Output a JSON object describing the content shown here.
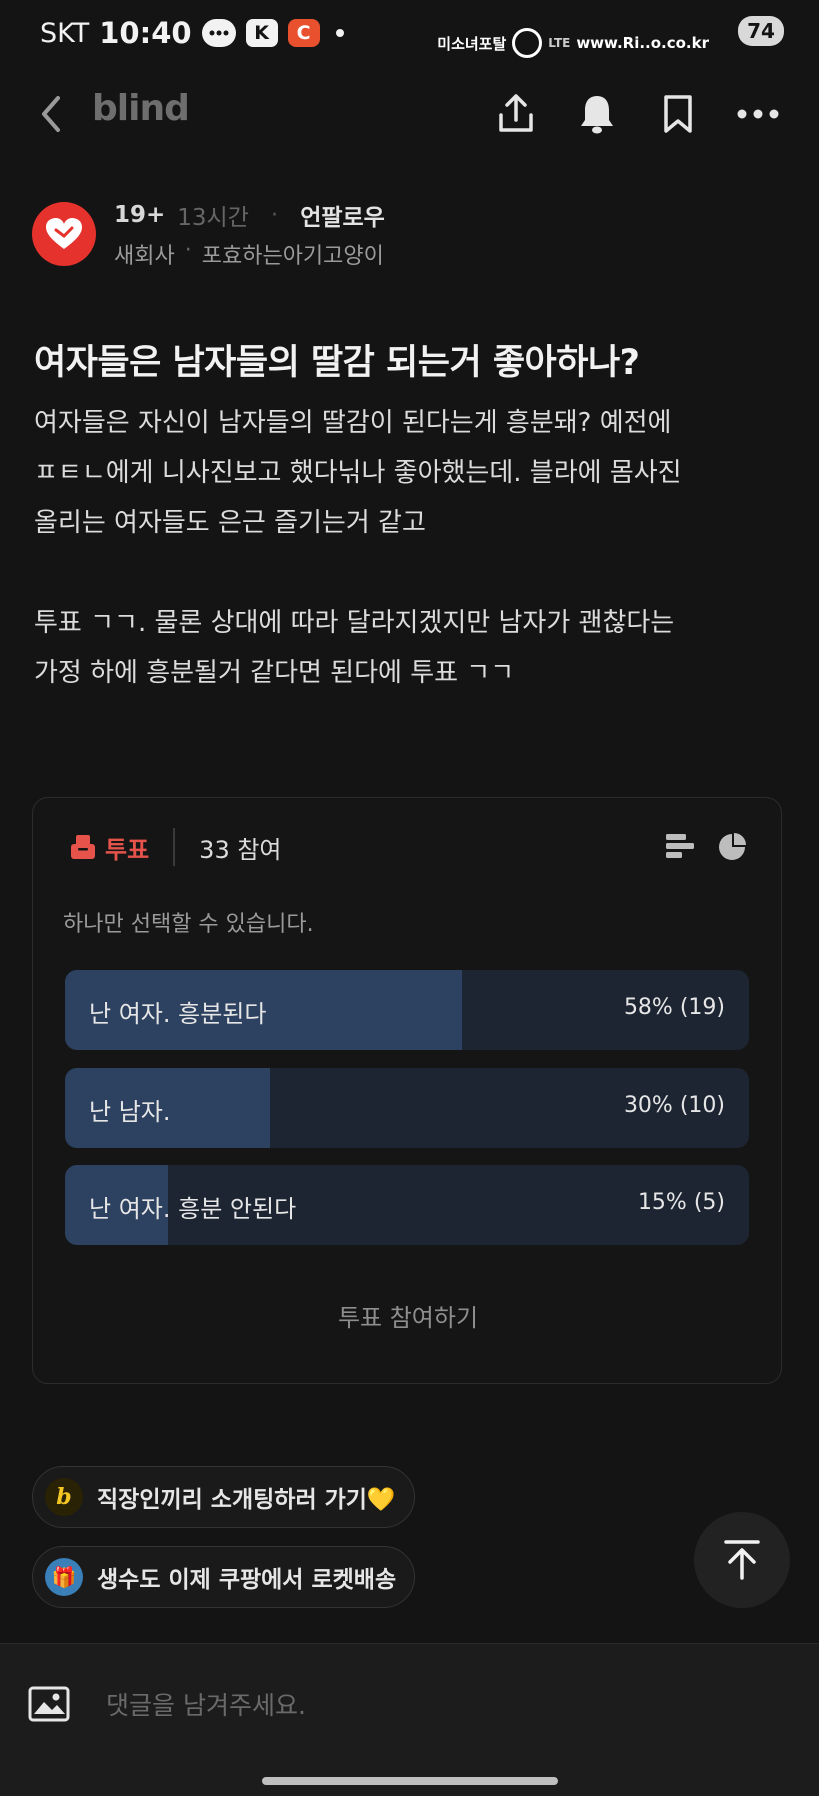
{
  "status_bar": {
    "carrier": "SKT",
    "time": "10:40",
    "k_badge": "K",
    "c_badge": "C",
    "watermark_left": "미소녀포탈",
    "watermark_right": "www.Ri..o.co.kr",
    "network": "LTE",
    "battery": "74"
  },
  "nav": {
    "logo": "blind",
    "icons": [
      "back-icon",
      "share-icon",
      "bell-icon",
      "bookmark-icon",
      "more-icon"
    ]
  },
  "author": {
    "age_badge": "19+",
    "time_ago": "13시간",
    "company": "언팔로우",
    "category": "새회사",
    "nickname": "포효하는아기고양이"
  },
  "post": {
    "title": "여자들은 남자들의 딸감 되는거 좋아하나?",
    "paragraphs": [
      "여자들은 자신이 남자들의 딸감이 된다는게 흥분돼? 예전에\nㅍㅌㄴ에게 니사진보고 했다닊나 좋아했는데. 블라에 몸사진\n올리는 여자들도 은근 즐기는거 같고",
      "투표 ㄱㄱ. 물론 상대에 따라 달라지겠지만 남자가 괜찮다는\n가정 하에 흥분될거 같다면 된다에 투표 ㄱㄱ"
    ]
  },
  "poll": {
    "label": "투표",
    "participants": "33 참여",
    "hint": "하나만 선택할 수 있습니다.",
    "options": [
      {
        "text": "난 여자. 흥분된다",
        "result": "58% (19)",
        "percent": 58
      },
      {
        "text": "난 남자.",
        "result": "30% (10)",
        "percent": 30
      },
      {
        "text": "난 여자. 흥분 안된다",
        "result": "15% (5)",
        "percent": 15
      }
    ],
    "vote_button": "투표 참여하기",
    "accent_color": "#e5534b",
    "bar_fill_color": "#2d4160",
    "bar_track_color": "#1d2532"
  },
  "promos": [
    {
      "icon_text": "b",
      "text": "직장인끼리 소개팅하러 가기💛"
    },
    {
      "icon_text": "🎁",
      "text": "생수도 이제 쿠팡에서 로켓배송"
    }
  ],
  "comment": {
    "placeholder": "댓글을 남겨주세요."
  }
}
